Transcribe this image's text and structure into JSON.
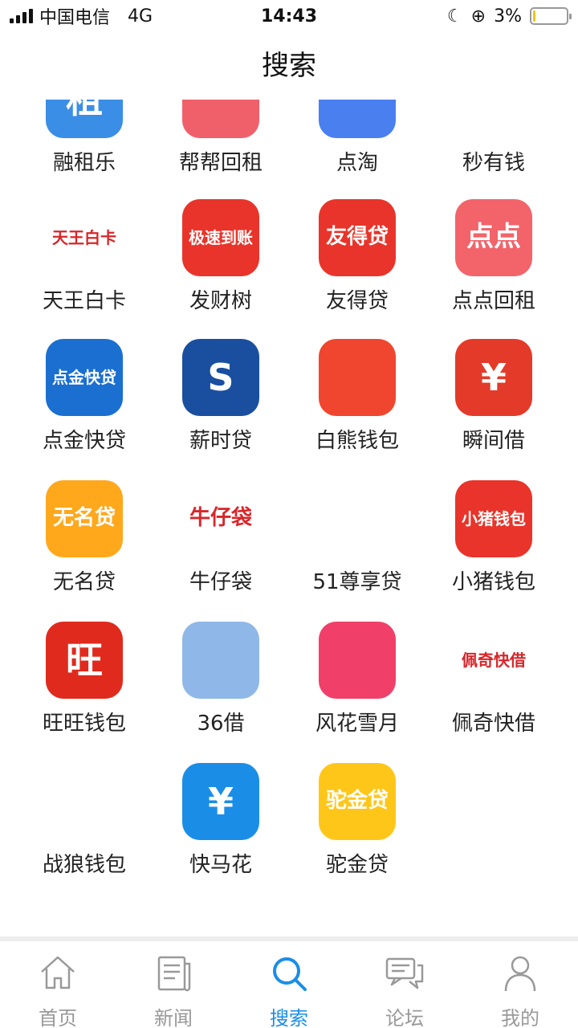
{
  "status_bar": {
    "carrier": "中国电信",
    "network": "4G",
    "time": "14:43",
    "battery_text": "3%",
    "battery_level": 0.03
  },
  "header": {
    "title": "搜索"
  },
  "apps": [
    {
      "label": "融租乐",
      "icon": "rongzule-icon",
      "color": "#3a8ee6",
      "text": "租"
    },
    {
      "label": "帮帮回租",
      "icon": "bangbang-icon",
      "color": "#f0606a",
      "text": ""
    },
    {
      "label": "点淘",
      "icon": "diantao-icon",
      "color": "#4a7ff0",
      "text": ""
    },
    {
      "label": "秒有钱",
      "icon": "miaoyouqian-icon",
      "color": "#ffffff",
      "text": ""
    },
    {
      "label": "天王白卡",
      "icon": "tianwang-icon",
      "color": "#ffffff",
      "text": "天王白卡"
    },
    {
      "label": "发财树",
      "icon": "facaishu-icon",
      "color": "#e8342a",
      "text": "极速到账"
    },
    {
      "label": "友得贷",
      "icon": "youdedai-icon",
      "color": "#e8342a",
      "text": "友得贷"
    },
    {
      "label": "点点回租",
      "icon": "diandian-icon",
      "color": "#f2646a",
      "text": "点点"
    },
    {
      "label": "点金快贷",
      "icon": "dianjin-icon",
      "color": "#1a6fd0",
      "text": "点金快贷"
    },
    {
      "label": "薪时贷",
      "icon": "xinshidai-icon",
      "color": "#1a4fa0",
      "text": "S"
    },
    {
      "label": "白熊钱包",
      "icon": "baixiong-icon",
      "color": "#f0452e",
      "text": ""
    },
    {
      "label": "瞬间借",
      "icon": "shunjian-icon",
      "color": "#e33a2a",
      "text": "¥"
    },
    {
      "label": "无名贷",
      "icon": "wumingdai-icon",
      "color": "#ffa81c",
      "text": "无名贷"
    },
    {
      "label": "牛仔袋",
      "icon": "niuzai-icon",
      "color": "#ffffff",
      "text": "牛仔袋"
    },
    {
      "label": "51尊享贷",
      "icon": "zunxiang-icon",
      "color": "#ffffff",
      "text": ""
    },
    {
      "label": "小猪钱包",
      "icon": "xiaozhu-icon",
      "color": "#e8342a",
      "text": "小猪钱包"
    },
    {
      "label": "旺旺钱包",
      "icon": "wangwang-icon",
      "color": "#e02a1e",
      "text": "旺"
    },
    {
      "label": "36借",
      "icon": "36jie-icon",
      "color": "#8fb8e8",
      "text": ""
    },
    {
      "label": "风花雪月",
      "icon": "fenghua-icon",
      "color": "#f0406a",
      "text": ""
    },
    {
      "label": "佩奇快借",
      "icon": "peiqi-icon",
      "color": "#ffffff",
      "text": "佩奇快借"
    },
    {
      "label": "战狼钱包",
      "icon": "zhanlang-icon",
      "color": "#ffffff",
      "text": ""
    },
    {
      "label": "快马花",
      "icon": "kuaima-icon",
      "color": "#1a8ee6",
      "text": "¥"
    },
    {
      "label": "驼金贷",
      "icon": "tuojin-icon",
      "color": "#ffc61a",
      "text": "驼金贷"
    }
  ],
  "tabs": [
    {
      "label": "首页",
      "icon": "home-icon",
      "active": false
    },
    {
      "label": "新闻",
      "icon": "news-icon",
      "active": false
    },
    {
      "label": "搜索",
      "icon": "search-icon",
      "active": true
    },
    {
      "label": "论坛",
      "icon": "forum-icon",
      "active": false
    },
    {
      "label": "我的",
      "icon": "profile-icon",
      "active": false
    }
  ],
  "colors": {
    "accent": "#1a8ee6",
    "inactive": "#999999"
  }
}
